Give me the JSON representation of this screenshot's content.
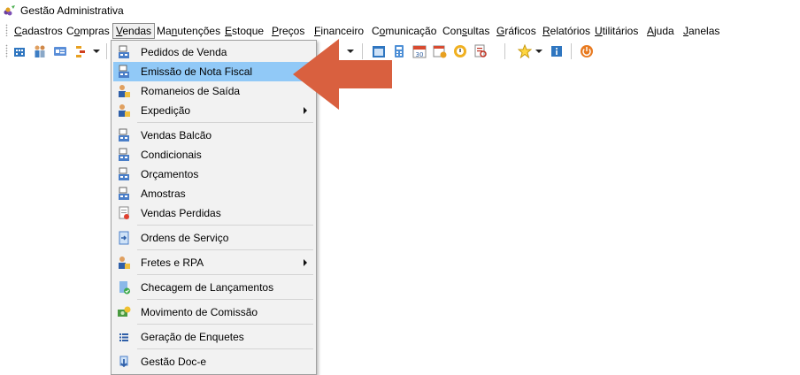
{
  "window": {
    "title": "Gestão Administrativa",
    "app_icon": "grapes-icon"
  },
  "menubar": {
    "items": [
      {
        "label": "Cadastros",
        "u": "C",
        "rest": "adastros"
      },
      {
        "label": "Compras",
        "u": "o",
        "pre": "C",
        "rest": "mpras"
      },
      {
        "label": "Vendas",
        "u": "V",
        "rest": "endas",
        "active": true
      },
      {
        "label": "Manutenções",
        "pre": "Ma",
        "u": "n",
        "rest": "utenções"
      },
      {
        "label": "Estoque",
        "u": "E",
        "rest": "stoque"
      },
      {
        "label": "Preços",
        "u": "P",
        "rest": "reços"
      },
      {
        "label": "Financeiro",
        "u": "F",
        "rest": "inanceiro"
      },
      {
        "label": "Comunicação",
        "pre": "C",
        "u": "o",
        "rest": "municação"
      },
      {
        "label": "Consultas",
        "pre": "Con",
        "u": "s",
        "rest": "ultas"
      },
      {
        "label": "Gráficos",
        "u": "G",
        "rest": "ráficos"
      },
      {
        "label": "Relatórios",
        "u": "R",
        "rest": "elatórios"
      },
      {
        "label": "Utilitários",
        "u": "U",
        "rest": "tilitários"
      },
      {
        "label": "Ajuda",
        "u": "A",
        "rest": "juda"
      },
      {
        "label": "Janelas",
        "u": "J",
        "rest": "anelas"
      }
    ]
  },
  "toolbar": {
    "icons": [
      "building-icon",
      "people-icon",
      "id-card-icon",
      "org-chart-icon",
      "calculator-icon",
      "calendar-icon",
      "schedule-icon",
      "lock-clock-icon",
      "report-icon",
      "star-icon",
      "info-icon",
      "power-icon"
    ]
  },
  "vendas_menu": {
    "items": [
      {
        "label": "Pedidos de Venda",
        "icon": "register-icon"
      },
      {
        "label": "Emissão de Nota Fiscal",
        "icon": "register-icon",
        "selected": true
      },
      {
        "label": "Romaneios de Saída",
        "icon": "user-doc-icon"
      },
      {
        "label": "Expedição",
        "icon": "user-doc-icon",
        "submenu": true
      },
      {
        "label": "Vendas Balcão",
        "icon": "register-icon"
      },
      {
        "label": "Condicionais",
        "icon": "register-icon"
      },
      {
        "label": "Orçamentos",
        "icon": "register-icon"
      },
      {
        "label": "Amostras",
        "icon": "register-icon"
      },
      {
        "label": "Vendas Perdidas",
        "icon": "lost-sales-icon"
      },
      {
        "label": "Ordens de Serviço",
        "icon": "service-order-icon"
      },
      {
        "label": "Fretes e RPA",
        "icon": "user-doc-icon",
        "submenu": true
      },
      {
        "label": "Checagem de Lançamentos",
        "icon": "check-doc-icon"
      },
      {
        "label": "Movimento de Comissão",
        "icon": "money-icon"
      },
      {
        "label": "Geração de Enquetes",
        "icon": "list-icon"
      },
      {
        "label": "Gestão Doc-e",
        "icon": "download-doc-icon"
      }
    ]
  },
  "annotation": {
    "color": "#d9603f",
    "icon": "arrow-left-icon"
  }
}
